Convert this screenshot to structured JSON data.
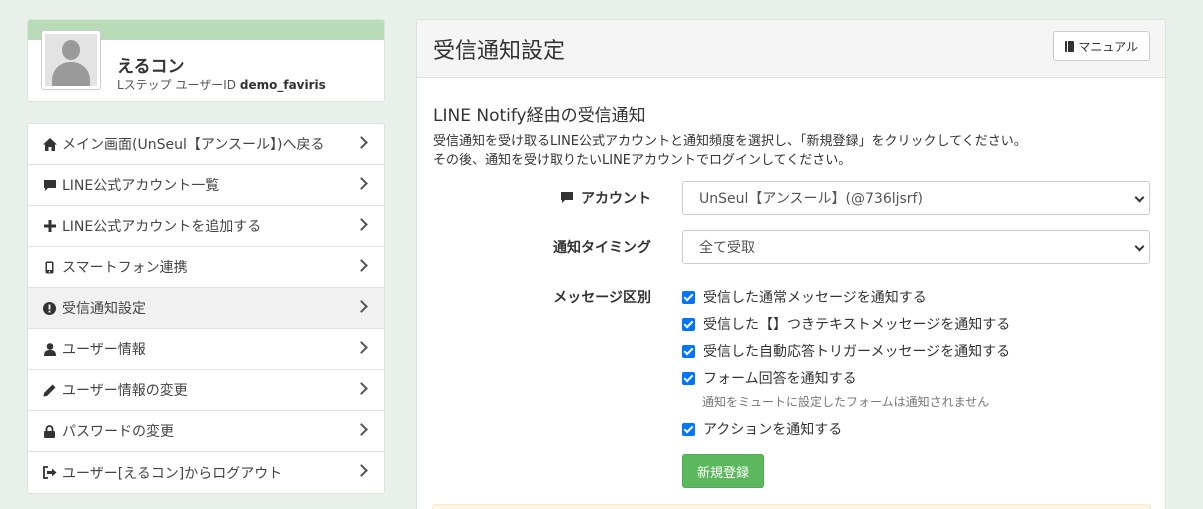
{
  "profile": {
    "name": "えるコン",
    "id_label": "Lステップ ユーザーID",
    "id_value": "demo_faviris"
  },
  "menu": [
    {
      "icon": "home-icon",
      "label": "メイン画面(UnSeul【アンスール】)へ戻る"
    },
    {
      "icon": "comment-icon",
      "label": "LINE公式アカウント一覧"
    },
    {
      "icon": "plus-icon",
      "label": "LINE公式アカウントを追加する"
    },
    {
      "icon": "phone-icon",
      "label": "スマートフォン連携"
    },
    {
      "icon": "exclamation-circle-icon",
      "label": "受信通知設定",
      "active": true
    },
    {
      "icon": "user-icon",
      "label": "ユーザー情報"
    },
    {
      "icon": "pencil-icon",
      "label": "ユーザー情報の変更"
    },
    {
      "icon": "lock-icon",
      "label": "パスワードの変更"
    },
    {
      "icon": "logout-icon",
      "label": "ユーザー[えるコン]からログアウト"
    }
  ],
  "main": {
    "title": "受信通知設定",
    "manual_label": "マニュアル",
    "section_title": "LINE Notify経由の受信通知",
    "desc_line1": "受信通知を受け取るLINE公式アカウントと通知頻度を選択し、「新規登録」をクリックしてください。",
    "desc_line2": "その後、通知を受け取りたいLINEアカウントでログインしてください。",
    "account_label": "アカウント",
    "account_value": "UnSeul【アンスール】(@736ljsrf)",
    "timing_label": "通知タイミング",
    "timing_value": "全て受取",
    "message_label": "メッセージ区別",
    "checkboxes": [
      {
        "label": "受信した通常メッセージを通知する",
        "checked": true
      },
      {
        "label": "受信した【】つきテキストメッセージを通知する",
        "checked": true
      },
      {
        "label": "受信した自動応答トリガーメッセージを通知する",
        "checked": true
      },
      {
        "label": "フォーム回答を通知する",
        "checked": true
      },
      {
        "label": "アクションを通知する",
        "checked": true
      }
    ],
    "form_help": "通知をミュートに設定したフォームは通知されません",
    "submit_label": "新規登録"
  },
  "colors": {
    "accent_green": "#5cb85c",
    "profile_band": "#b8dcb8",
    "checkbox_blue": "#0075ff",
    "background": "#e8f0ea"
  }
}
